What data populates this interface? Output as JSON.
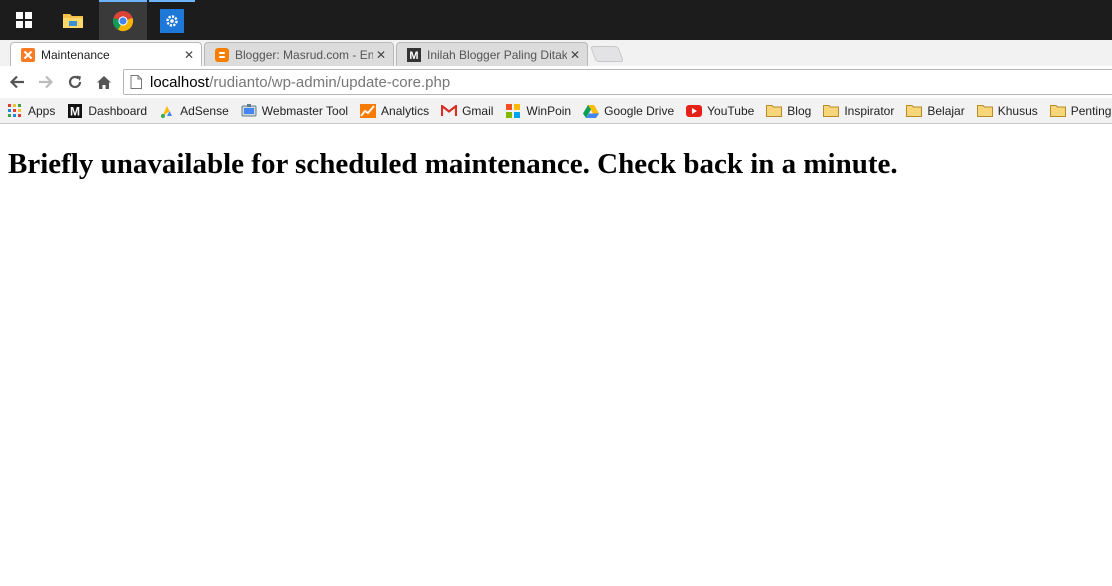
{
  "taskbar": {
    "items": [
      "windows-start",
      "file-explorer",
      "google-chrome",
      "settings"
    ]
  },
  "tabs": [
    {
      "title": "Maintenance",
      "favicon": "xampp-icon",
      "active": true
    },
    {
      "title": "Blogger: Masrud.com - En",
      "favicon": "blogger-icon",
      "active": false
    },
    {
      "title": "Inilah Blogger Paling Ditak",
      "favicon": "medium-icon",
      "active": false
    }
  ],
  "toolbar": {
    "url_host": "localhost",
    "url_path": "/rudianto/wp-admin/update-core.php"
  },
  "bookmarks": [
    {
      "label": "Apps",
      "icon": "apps-grid-icon"
    },
    {
      "label": "Dashboard",
      "icon": "medium-icon"
    },
    {
      "label": "AdSense",
      "icon": "adsense-icon"
    },
    {
      "label": "Webmaster Tool",
      "icon": "webmaster-icon"
    },
    {
      "label": "Analytics",
      "icon": "analytics-icon"
    },
    {
      "label": "Gmail",
      "icon": "gmail-icon"
    },
    {
      "label": "WinPoin",
      "icon": "winpoin-icon"
    },
    {
      "label": "Google Drive",
      "icon": "drive-icon"
    },
    {
      "label": "YouTube",
      "icon": "youtube-icon"
    },
    {
      "label": "Blog",
      "icon": "folder-icon"
    },
    {
      "label": "Inspirator",
      "icon": "folder-icon"
    },
    {
      "label": "Belajar",
      "icon": "folder-icon"
    },
    {
      "label": "Khusus",
      "icon": "folder-icon"
    },
    {
      "label": "Penting",
      "icon": "folder-icon"
    }
  ],
  "page": {
    "message": "Briefly unavailable for scheduled maintenance. Check back in a minute."
  },
  "colors": {
    "taskbar_bg": "#1c1c1c",
    "taskbar_accent": "#6cb2ff",
    "chrome_frame": "#f2f2f2"
  }
}
